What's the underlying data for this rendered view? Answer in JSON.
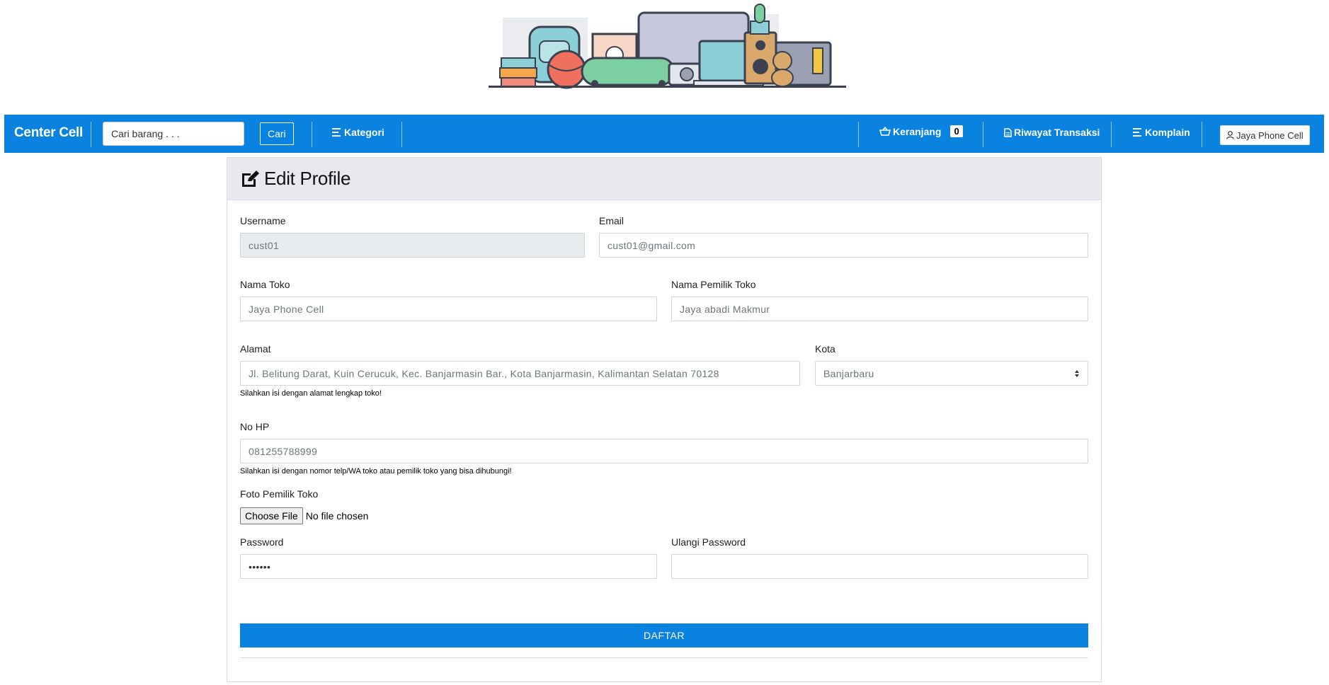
{
  "navbar": {
    "brand": "Center Cell",
    "search_placeholder": "Cari barang . . .",
    "search_button": "Cari",
    "kategori": "Kategori",
    "keranjang": "Keranjang",
    "cart_count": "0",
    "riwayat": "Riwayat Transaksi",
    "komplain": "Komplain",
    "user": "Jaya Phone Cell",
    "color": "#0a82df"
  },
  "form": {
    "title": "Edit Profile",
    "username": {
      "label": "Username",
      "value": "cust01"
    },
    "email": {
      "label": "Email",
      "value": "cust01@gmail.com"
    },
    "nama_toko": {
      "label": "Nama Toko",
      "value": "Jaya Phone Cell"
    },
    "nama_pemilik": {
      "label": "Nama Pemilik Toko",
      "value": "Jaya abadi Makmur"
    },
    "alamat": {
      "label": "Alamat",
      "value": "Jl. Belitung Darat, Kuin Cerucuk, Kec. Banjarmasin Bar., Kota Banjarmasin, Kalimantan Selatan 70128",
      "help": "Silahkan isi dengan alamat lengkap toko!"
    },
    "kota": {
      "label": "Kota",
      "value": "Banjarbaru"
    },
    "no_hp": {
      "label": "No HP",
      "value": "081255788999",
      "help": "Silahkan isi dengan nomor telp/WA toko atau pemilik toko yang bisa dihubungi!"
    },
    "foto": {
      "label": "Foto Pemilik Toko",
      "button": "Choose File",
      "status": "No file chosen"
    },
    "password": {
      "label": "Password",
      "value": "••••••"
    },
    "ulangi_password": {
      "label": "Ulangi Password",
      "value": ""
    },
    "submit": "DAFTAR"
  },
  "icons": [
    "edit-icon",
    "list-icon",
    "basket-icon",
    "receipt-icon",
    "user-icon",
    "chevron-updown-icon"
  ]
}
